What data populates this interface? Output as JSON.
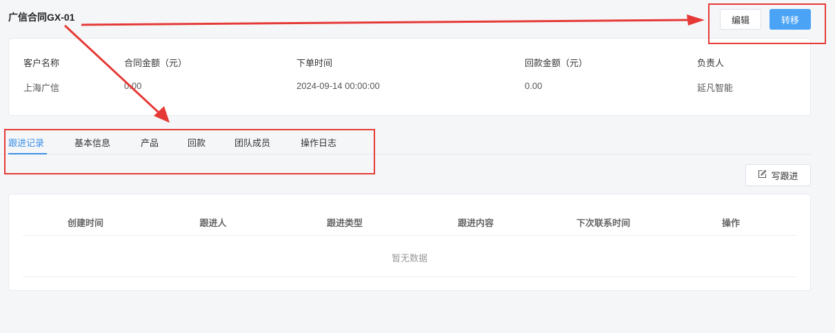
{
  "header": {
    "title": "广信合同GX-01",
    "edit_label": "编辑",
    "transfer_label": "转移",
    "transfer_color": "#4ba3f5"
  },
  "summary": {
    "fields": [
      {
        "label": "客户名称",
        "value": "上海广信"
      },
      {
        "label": "合同金额（元）",
        "value": "0.00"
      },
      {
        "label": "下单时间",
        "value": "2024-09-14 00:00:00"
      },
      {
        "label": "回款金额（元）",
        "value": "0.00"
      },
      {
        "label": "负责人",
        "value": "延凡智能"
      }
    ]
  },
  "tabs": [
    {
      "label": "跟进记录",
      "active": true
    },
    {
      "label": "基本信息"
    },
    {
      "label": "产品"
    },
    {
      "label": "回款"
    },
    {
      "label": "团队成员"
    },
    {
      "label": "操作日志"
    }
  ],
  "toolbar": {
    "write_followup_label": "写跟进",
    "write_icon": "edit-icon"
  },
  "table": {
    "columns": [
      "创建时间",
      "跟进人",
      "跟进类型",
      "跟进内容",
      "下次联系时间",
      "操作"
    ],
    "empty_text": "暂无数据"
  },
  "annotations": {
    "color": "#e53935"
  }
}
